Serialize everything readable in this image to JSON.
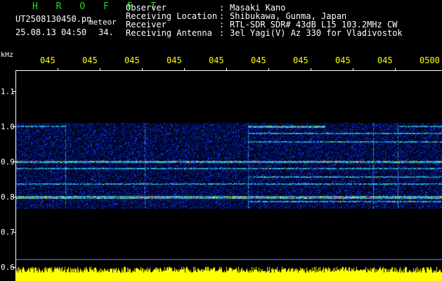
{
  "header": {
    "brand": "H R O F F T",
    "filename": "UT2508130450.pn",
    "meteor_label": "meteor",
    "date_time": "25.08.13 04:50",
    "count": "34.",
    "rows": [
      {
        "key": "Observer",
        "colon": ":",
        "value": "Masaki Kano"
      },
      {
        "key": "Receiving Location",
        "colon": ":",
        "value": "Shibukawa, Gunma, Japan"
      },
      {
        "key": "Receiver",
        "colon": ":",
        "value": "RTL-SDR SDR# 43dB L15 103.2MHz CW"
      },
      {
        "key": "Receiving Antenna",
        "colon": ":",
        "value": "3el Yagi(V) Az 330 for Vladivostok"
      }
    ]
  },
  "axis": {
    "unit": "kHz",
    "y_labels": [
      "1.1",
      "1.0",
      "0.9",
      "0.8",
      "0.7",
      "0.6"
    ],
    "x_labels": [
      "045",
      "045",
      "045",
      "045",
      "045",
      "045",
      "045",
      "045",
      "045",
      "0500"
    ]
  },
  "colors": {
    "background": "#000000",
    "title_green": "#22dd22",
    "time_labels": "#ffff00",
    "noise_floor": "#ffff00",
    "baseline": "#5a8cff"
  }
}
